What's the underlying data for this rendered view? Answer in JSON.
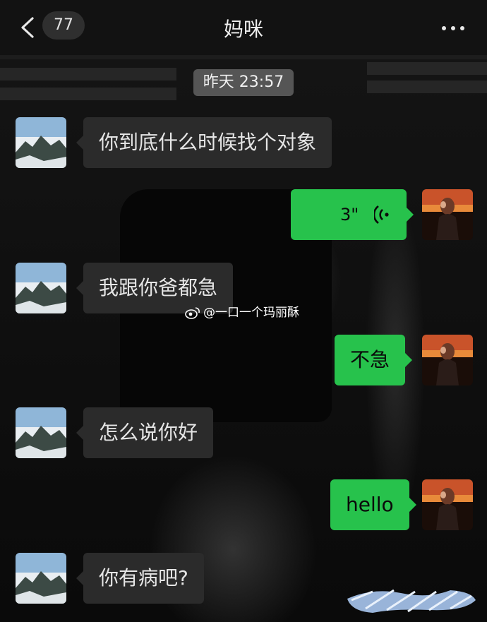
{
  "header": {
    "back_count": "77",
    "title": "妈咪"
  },
  "timestamp": "昨天 23:57",
  "messages": [
    {
      "side": "in",
      "text": "你到底什么时候找个对象"
    },
    {
      "side": "out",
      "type": "voice",
      "duration": "3\""
    },
    {
      "side": "in",
      "text": "我跟你爸都急"
    },
    {
      "side": "out",
      "text": "不急"
    },
    {
      "side": "in",
      "text": "怎么说你好"
    },
    {
      "side": "out",
      "text": "hello"
    },
    {
      "side": "in",
      "text": "你有病吧?"
    }
  ],
  "watermark": "@一口一个玛丽酥",
  "colors": {
    "outgoing_bubble": "#27c24c",
    "incoming_bubble": "#2b2b2b",
    "time_pill": "#555555",
    "header": "#121212"
  },
  "icons": {
    "back": "chevron-left-icon",
    "more": "more-dots-icon",
    "voice": "voice-wave-icon",
    "weibo": "weibo-logo-icon"
  }
}
